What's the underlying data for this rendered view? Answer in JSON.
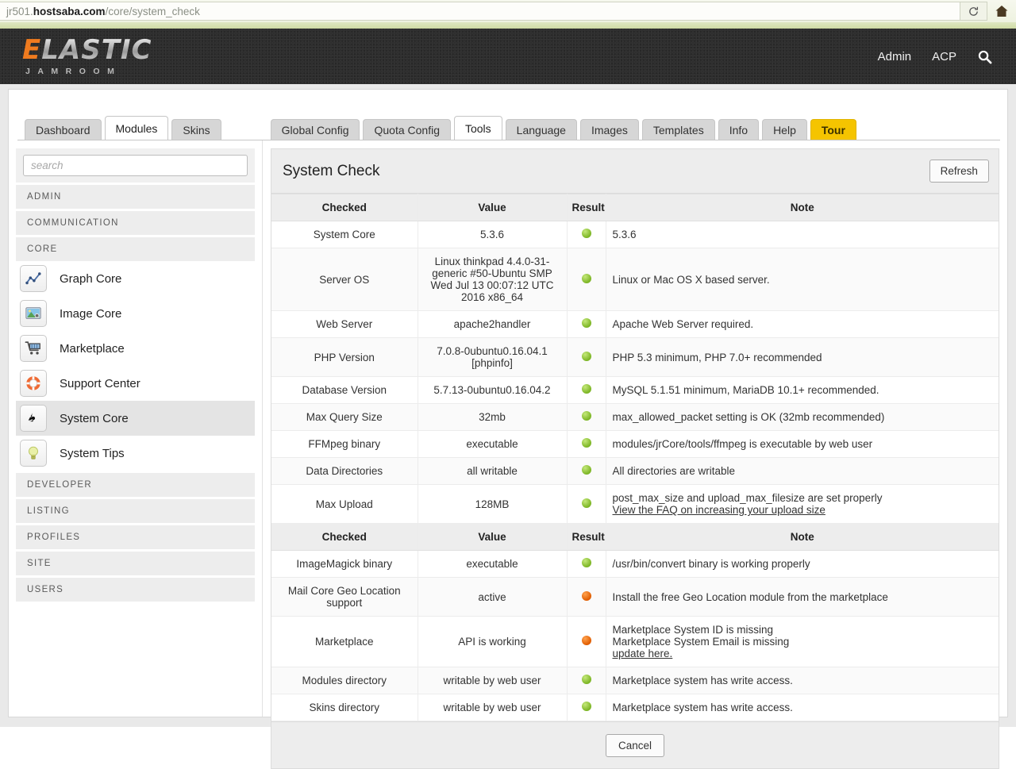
{
  "browser": {
    "url_prefix": "jr501.",
    "url_domain": "hostsaba.com",
    "url_path": "/core/system_check",
    "reload_icon": "reload-icon",
    "home_icon": "home-icon"
  },
  "header": {
    "logo_first": "E",
    "logo_rest": "LASTIC",
    "logo_sub": "JAMROOM",
    "links": [
      "Admin",
      "ACP"
    ],
    "search_icon": "search-icon"
  },
  "tabs": {
    "primary": [
      {
        "label": "Dashboard",
        "active": false
      },
      {
        "label": "Modules",
        "active": true
      },
      {
        "label": "Skins",
        "active": false
      }
    ],
    "secondary": [
      {
        "label": "Global Config",
        "active": false,
        "style": "normal"
      },
      {
        "label": "Quota Config",
        "active": false,
        "style": "normal"
      },
      {
        "label": "Tools",
        "active": true,
        "style": "normal"
      },
      {
        "label": "Language",
        "active": false,
        "style": "normal"
      },
      {
        "label": "Images",
        "active": false,
        "style": "normal"
      },
      {
        "label": "Templates",
        "active": false,
        "style": "normal"
      },
      {
        "label": "Info",
        "active": false,
        "style": "normal"
      },
      {
        "label": "Help",
        "active": false,
        "style": "normal"
      },
      {
        "label": "Tour",
        "active": false,
        "style": "tour"
      }
    ]
  },
  "sidebar": {
    "search_placeholder": "search",
    "groups": [
      {
        "title": "ADMIN",
        "items": []
      },
      {
        "title": "COMMUNICATION",
        "items": []
      },
      {
        "title": "CORE",
        "items": [
          {
            "label": "Graph Core",
            "icon": "graph-icon",
            "selected": false
          },
          {
            "label": "Image Core",
            "icon": "image-icon",
            "selected": false
          },
          {
            "label": "Marketplace",
            "icon": "cart-icon",
            "selected": false
          },
          {
            "label": "Support Center",
            "icon": "lifering-icon",
            "selected": false
          },
          {
            "label": "System Core",
            "icon": "radiation-icon",
            "selected": true
          },
          {
            "label": "System Tips",
            "icon": "lightbulb-icon",
            "selected": false
          }
        ]
      },
      {
        "title": "DEVELOPER",
        "items": []
      },
      {
        "title": "LISTING",
        "items": []
      },
      {
        "title": "PROFILES",
        "items": []
      },
      {
        "title": "SITE",
        "items": []
      },
      {
        "title": "USERS",
        "items": []
      }
    ]
  },
  "main": {
    "title": "System Check",
    "refresh_label": "Refresh",
    "cancel_label": "Cancel",
    "columns": [
      "Checked",
      "Value",
      "Result",
      "Note"
    ],
    "rows": [
      {
        "checked": "System Core",
        "value": "5.3.6",
        "result": "ok",
        "note_lines": [
          "5.3.6"
        ],
        "note_link": null
      },
      {
        "checked": "Server OS",
        "value": "Linux thinkpad 4.4.0-31-generic #50-Ubuntu SMP Wed Jul 13 00:07:12 UTC 2016 x86_64",
        "result": "ok",
        "note_lines": [
          "Linux or Mac OS X based server."
        ],
        "note_link": null
      },
      {
        "checked": "Web Server",
        "value": "apache2handler",
        "result": "ok",
        "note_lines": [
          "Apache Web Server required."
        ],
        "note_link": null
      },
      {
        "checked": "PHP Version",
        "value": "7.0.8-0ubuntu0.16.04.1 [phpinfo]",
        "result": "ok",
        "note_lines": [
          "PHP 5.3 minimum, PHP 7.0+ recommended"
        ],
        "note_link": null
      },
      {
        "checked": "Database Version",
        "value": "5.7.13-0ubuntu0.16.04.2",
        "result": "ok",
        "note_lines": [
          "MySQL 5.1.51 minimum, MariaDB 10.1+ recommended."
        ],
        "note_link": null
      },
      {
        "checked": "Max Query Size",
        "value": "32mb",
        "result": "ok",
        "note_lines": [
          "max_allowed_packet setting is OK (32mb recommended)"
        ],
        "note_link": null
      },
      {
        "checked": "FFMpeg binary",
        "value": "executable",
        "result": "ok",
        "note_lines": [
          "modules/jrCore/tools/ffmpeg is executable by web user"
        ],
        "note_link": null
      },
      {
        "checked": "Data Directories",
        "value": "all writable",
        "result": "ok",
        "note_lines": [
          "All directories are writable"
        ],
        "note_link": null
      },
      {
        "checked": "Max Upload",
        "value": "128MB",
        "result": "ok",
        "note_lines": [
          "post_max_size and upload_max_filesize are set properly"
        ],
        "note_link": "View the FAQ on increasing your upload size"
      }
    ],
    "rows2": [
      {
        "checked": "ImageMagick binary",
        "value": "executable",
        "result": "ok",
        "note_lines": [
          "/usr/bin/convert binary is working properly"
        ],
        "note_link": null
      },
      {
        "checked": "Mail Core Geo Location support",
        "value": "active",
        "result": "warn",
        "note_lines": [
          "Install the free Geo Location module from the marketplace"
        ],
        "note_link": null
      },
      {
        "checked": "Marketplace",
        "value": "API is working",
        "result": "warn",
        "note_lines": [
          "Marketplace System ID is missing",
          "Marketplace System Email is missing"
        ],
        "note_link": "update here."
      },
      {
        "checked": "Modules directory",
        "value": "writable by web user",
        "result": "ok",
        "note_lines": [
          "Marketplace system has write access."
        ],
        "note_link": null
      },
      {
        "checked": "Skins directory",
        "value": "writable by web user",
        "result": "ok",
        "note_lines": [
          "Marketplace system has write access."
        ],
        "note_link": null
      }
    ]
  },
  "colors": {
    "ok": "#8fc931",
    "warn": "#ef6c11",
    "tour": "#f5c400",
    "logo_accent": "#ef7b1f",
    "header_bg": "#2e2e2e"
  }
}
